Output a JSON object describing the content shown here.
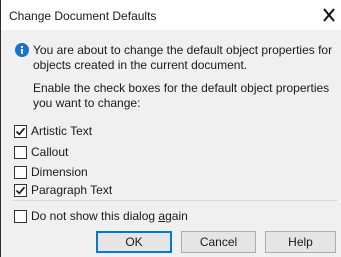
{
  "window": {
    "title": "Change Document Defaults",
    "close_icon": "close-icon"
  },
  "info": {
    "icon": "info-icon",
    "icon_color": "#1a6fd0",
    "message": "You are about to change the default object properties for objects created in the current document."
  },
  "instructions": "Enable the check boxes for the default object properties you want to change:",
  "options": [
    {
      "label": "Artistic Text",
      "checked": true
    },
    {
      "label": "Callout",
      "checked": false
    },
    {
      "label": "Dimension",
      "checked": false
    },
    {
      "label": "Paragraph Text",
      "checked": true
    }
  ],
  "dont_show": {
    "label_before": "Do not show this dialog ",
    "label_accel": "a",
    "label_after": "gain",
    "checked": false
  },
  "buttons": {
    "ok": "OK",
    "cancel": "Cancel",
    "help": "Help"
  },
  "colors": {
    "accent": "#0078d7",
    "client_bg": "#f0f0f0"
  }
}
